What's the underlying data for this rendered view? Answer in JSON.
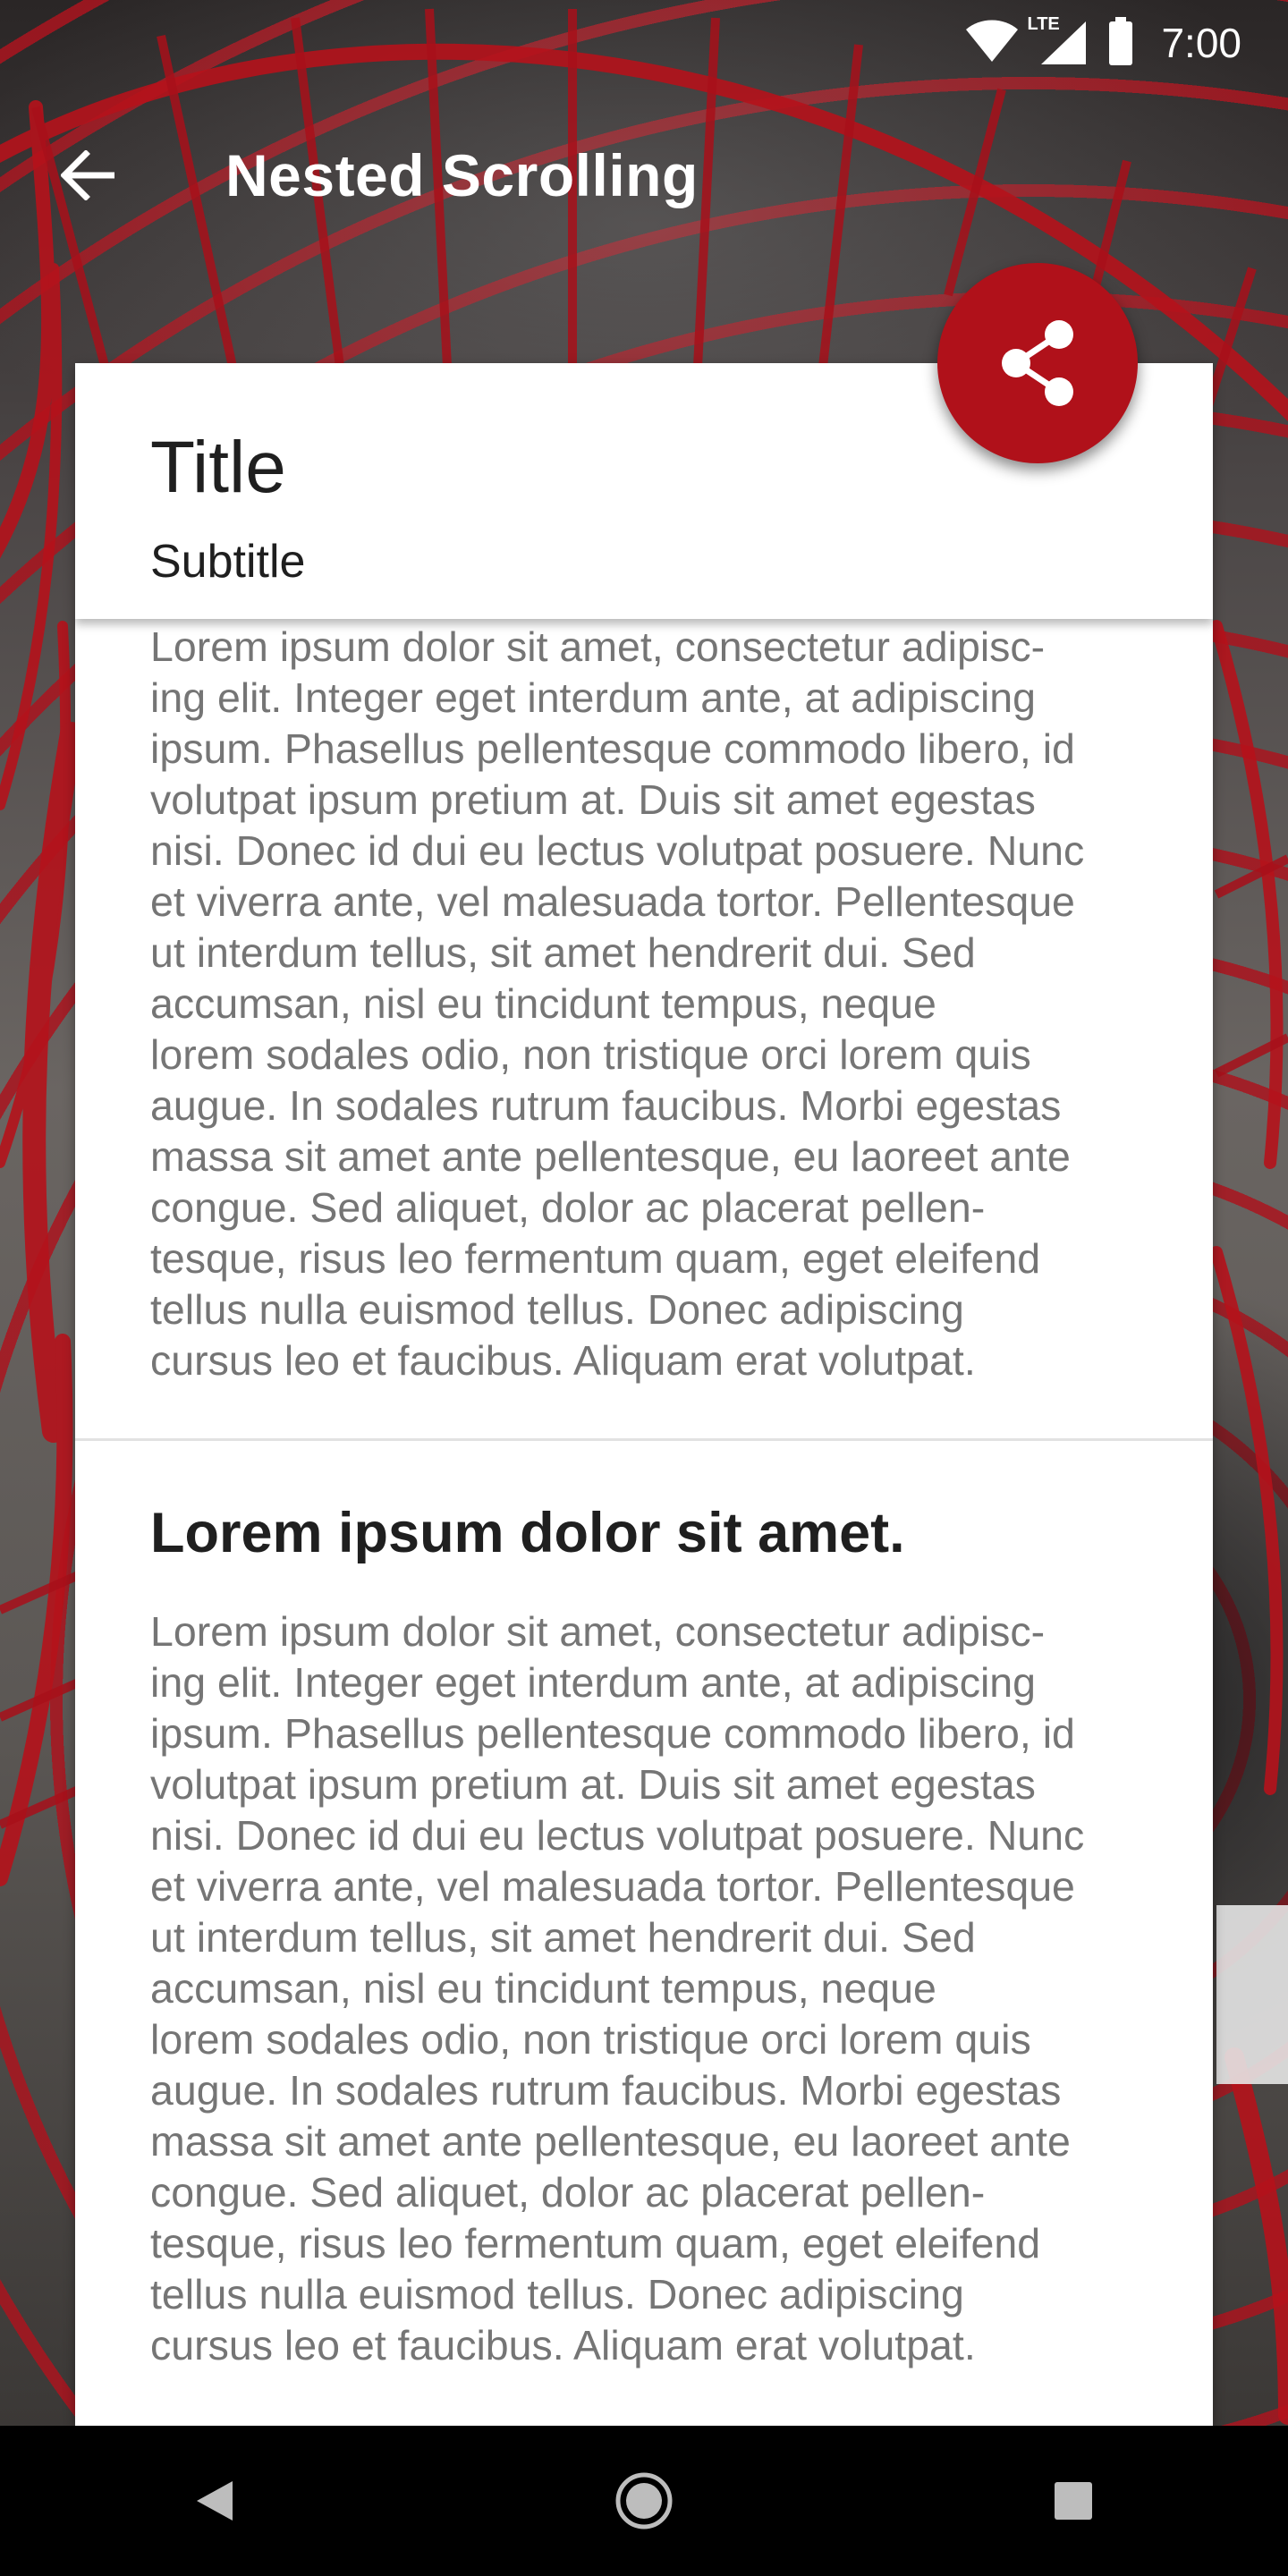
{
  "status_bar": {
    "time": "7:00",
    "network_label": "LTE",
    "icons": [
      "wifi-icon",
      "cell-signal-icon",
      "battery-icon"
    ]
  },
  "app_bar": {
    "title": "Nested Scrolling",
    "back_icon": "arrow-back-icon"
  },
  "card": {
    "title": "Title",
    "subtitle": "Subtitle",
    "sections": [
      {
        "body": "Lorem ipsum dolor sit amet, consectetur adipisc-\ning elit. Integer eget interdum ante, at adipiscing\nipsum. Phasellus pellentesque commodo libero, id\nvolutpat ipsum pretium at. Duis sit amet egestas\nnisi. Donec id dui eu lectus volutpat posuere. Nunc\net viverra ante, vel malesuada tortor. Pellentesque\nut interdum tellus, sit amet hendrerit dui. Sed\naccumsan, nisl eu tincidunt tempus, neque\nlorem sodales odio, non tristique orci lorem quis\naugue. In sodales rutrum faucibus. Morbi egestas\nmassa sit amet ante pellentesque, eu laoreet ante\ncongue. Sed aliquet, dolor ac placerat pellen-\ntesque, risus leo fermentum quam, eget eleifend\ntellus nulla euismod tellus. Donec adipiscing\ncursus leo et faucibus. Aliquam erat volutpat."
      },
      {
        "heading": "Lorem ipsum dolor sit amet.",
        "body": "Lorem ipsum dolor sit amet, consectetur adipisc-\ning elit. Integer eget interdum ante, at adipiscing\nipsum. Phasellus pellentesque commodo libero, id\nvolutpat ipsum pretium at. Duis sit amet egestas\nnisi. Donec id dui eu lectus volutpat posuere. Nunc\net viverra ante, vel malesuada tortor. Pellentesque\nut interdum tellus, sit amet hendrerit dui. Sed\naccumsan, nisl eu tincidunt tempus, neque\nlorem sodales odio, non tristique orci lorem quis\naugue. In sodales rutrum faucibus. Morbi egestas\nmassa sit amet ante pellentesque, eu laoreet ante\ncongue. Sed aliquet, dolor ac placerat pellen-\ntesque, risus leo fermentum quam, eget eleifend\ntellus nulla euismod tellus. Donec adipiscing\ncursus leo et faucibus. Aliquam erat volutpat."
      }
    ]
  },
  "fab": {
    "icon": "share-icon",
    "color": "#b0111a"
  },
  "nav_bar": {
    "buttons": [
      "back-triangle-icon",
      "home-circle-icon",
      "recents-square-icon"
    ]
  },
  "colors": {
    "accent": "#b0111a",
    "card_background": "#ffffff",
    "body_text": "#757575",
    "heading_text": "#1f1f1f"
  }
}
